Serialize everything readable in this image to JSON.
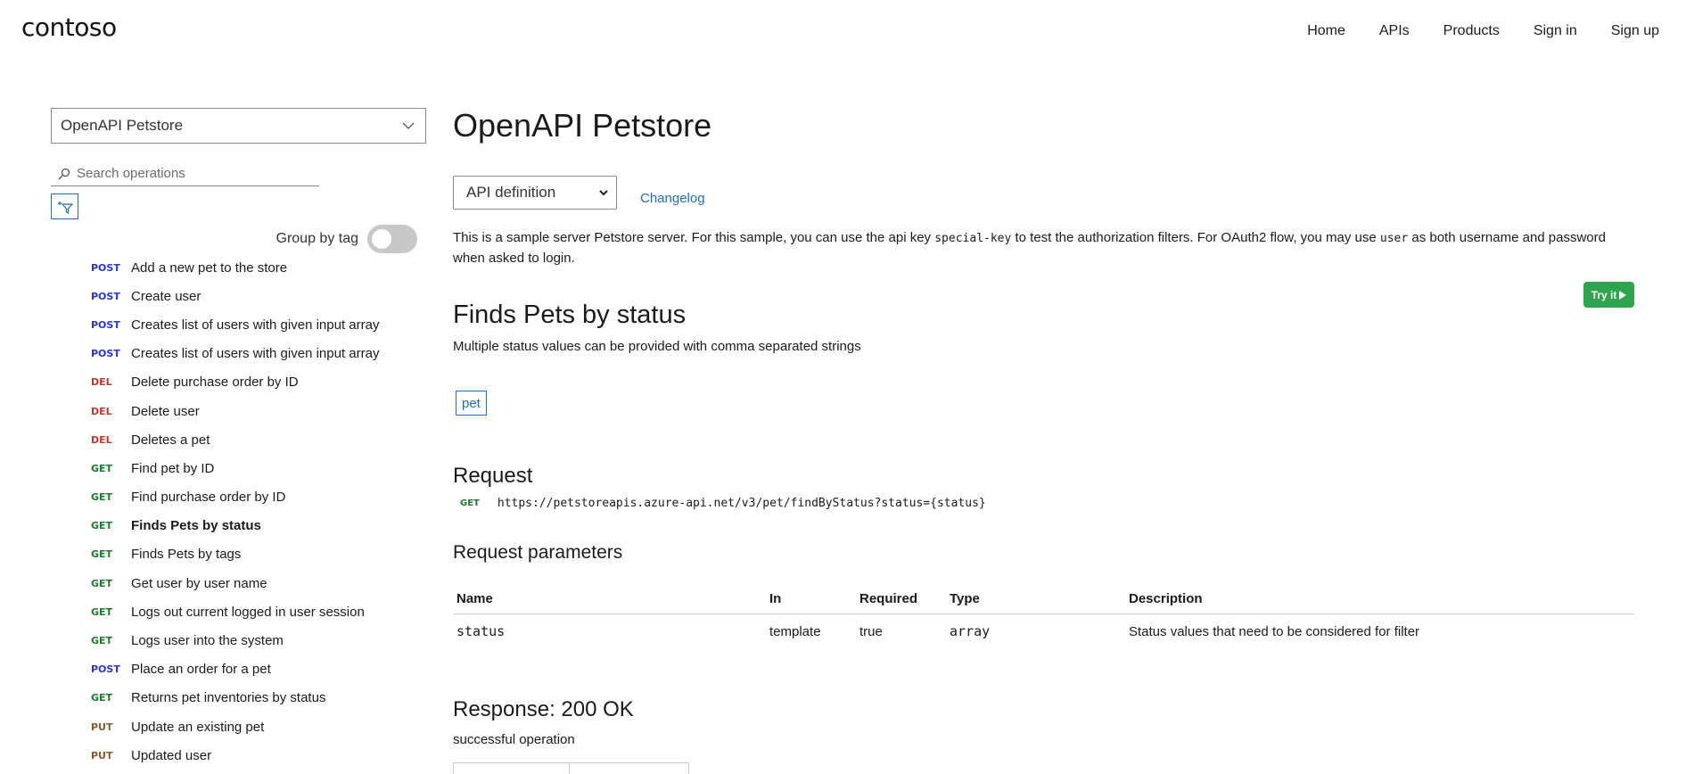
{
  "header": {
    "logo": "contoso",
    "nav": [
      "Home",
      "APIs",
      "Products",
      "Sign in",
      "Sign up"
    ]
  },
  "sidebar": {
    "api_select": "OpenAPI Petstore",
    "search_placeholder": "Search operations",
    "group_by_tag_label": "Group by tag",
    "group_by_tag_on": false,
    "operations": [
      {
        "verb": "POST",
        "name": "Add a new pet to the store"
      },
      {
        "verb": "POST",
        "name": "Create user"
      },
      {
        "verb": "POST",
        "name": "Creates list of users with given input array"
      },
      {
        "verb": "POST",
        "name": "Creates list of users with given input array"
      },
      {
        "verb": "DEL",
        "name": "Delete purchase order by ID"
      },
      {
        "verb": "DEL",
        "name": "Delete user"
      },
      {
        "verb": "DEL",
        "name": "Deletes a pet"
      },
      {
        "verb": "GET",
        "name": "Find pet by ID"
      },
      {
        "verb": "GET",
        "name": "Find purchase order by ID"
      },
      {
        "verb": "GET",
        "name": "Finds Pets by status",
        "active": true
      },
      {
        "verb": "GET",
        "name": "Finds Pets by tags"
      },
      {
        "verb": "GET",
        "name": "Get user by user name"
      },
      {
        "verb": "GET",
        "name": "Logs out current logged in user session"
      },
      {
        "verb": "GET",
        "name": "Logs user into the system"
      },
      {
        "verb": "POST",
        "name": "Place an order for a pet"
      },
      {
        "verb": "GET",
        "name": "Returns pet inventories by status"
      },
      {
        "verb": "PUT",
        "name": "Update an existing pet"
      },
      {
        "verb": "PUT",
        "name": "Updated user"
      }
    ]
  },
  "main": {
    "title": "OpenAPI Petstore",
    "definition_select": "API definition",
    "changelog": "Changelog",
    "description": {
      "part1": "This is a sample server Petstore server. For this sample, you can use the api key ",
      "code1": "special-key",
      "part2": " to test the authorization filters. For OAuth2 flow, you may use ",
      "code2": "user",
      "part3": " as both username and password when asked to login."
    },
    "try_it": "Try it",
    "operation_title": "Finds Pets by status",
    "operation_description": "Multiple status values can be provided with comma separated strings",
    "tag": "pet",
    "request_heading": "Request",
    "request_verb": "GET",
    "request_url": "https://petstoreapis.azure-api.net/v3/pet/findByStatus?status={status}",
    "params_heading": "Request parameters",
    "params_columns": [
      "Name",
      "In",
      "Required",
      "Type",
      "Description"
    ],
    "params_rows": [
      {
        "name": "status",
        "in": "template",
        "required": "true",
        "type": "array",
        "description": "Status values that need to be considered for filter"
      }
    ],
    "response_heading": "Response: 200 OK",
    "response_description": "successful operation"
  },
  "colors": {
    "post": "#2a37d6",
    "del": "#c0392b",
    "get": "#1f7a30",
    "put": "#8a5a2b",
    "link": "#1d6fbd",
    "try_button": "#2ea44f"
  }
}
